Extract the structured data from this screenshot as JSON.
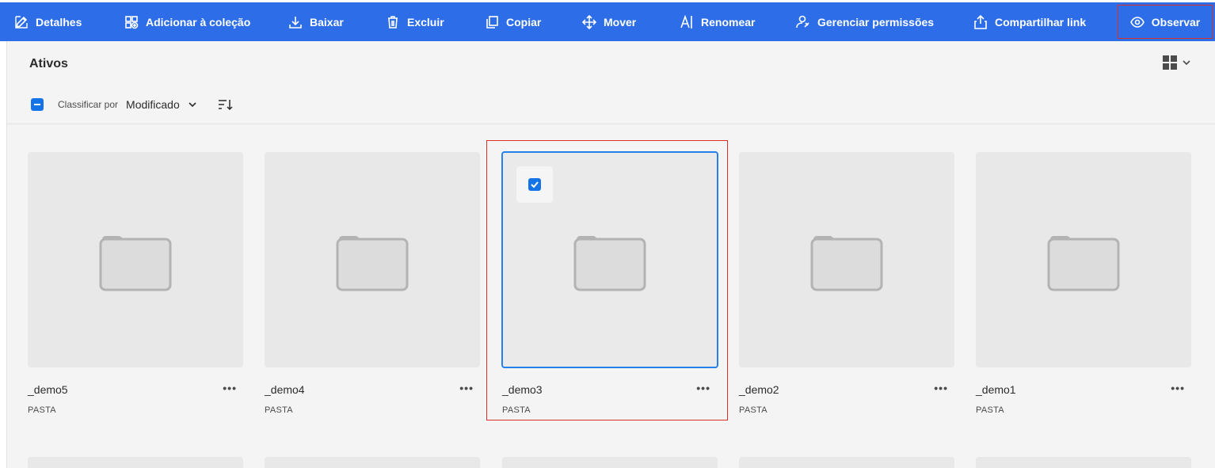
{
  "toolbar": {
    "items": [
      {
        "label": "Detalhes",
        "icon": "edit-icon"
      },
      {
        "label": "Adicionar à coleção",
        "icon": "add-collection-icon"
      },
      {
        "label": "Baixar",
        "icon": "download-icon"
      },
      {
        "label": "Excluir",
        "icon": "trash-icon"
      },
      {
        "label": "Copiar",
        "icon": "copy-icon"
      },
      {
        "label": "Mover",
        "icon": "move-icon"
      },
      {
        "label": "Renomear",
        "icon": "rename-icon"
      },
      {
        "label": "Gerenciar permissões",
        "icon": "manage-permissions-icon"
      },
      {
        "label": "Compartilhar link",
        "icon": "share-icon"
      },
      {
        "label": "Observar",
        "icon": "eye-icon"
      }
    ],
    "colors": {
      "background": "#2d6ee8",
      "highlight_outline": "#d9312a"
    }
  },
  "main": {
    "title": "Ativos",
    "sort": {
      "label": "Classificar por",
      "value": "Modificado"
    },
    "view_icon": "grid-view-icon"
  },
  "cards": [
    {
      "name": "_demo5",
      "type": "PASTA",
      "selected": false
    },
    {
      "name": "_demo4",
      "type": "PASTA",
      "selected": false
    },
    {
      "name": "_demo3",
      "type": "PASTA",
      "selected": true
    },
    {
      "name": "_demo2",
      "type": "PASTA",
      "selected": false
    },
    {
      "name": "_demo1",
      "type": "PASTA",
      "selected": false
    }
  ],
  "more_label": "•••",
  "accent": "#1473e6"
}
